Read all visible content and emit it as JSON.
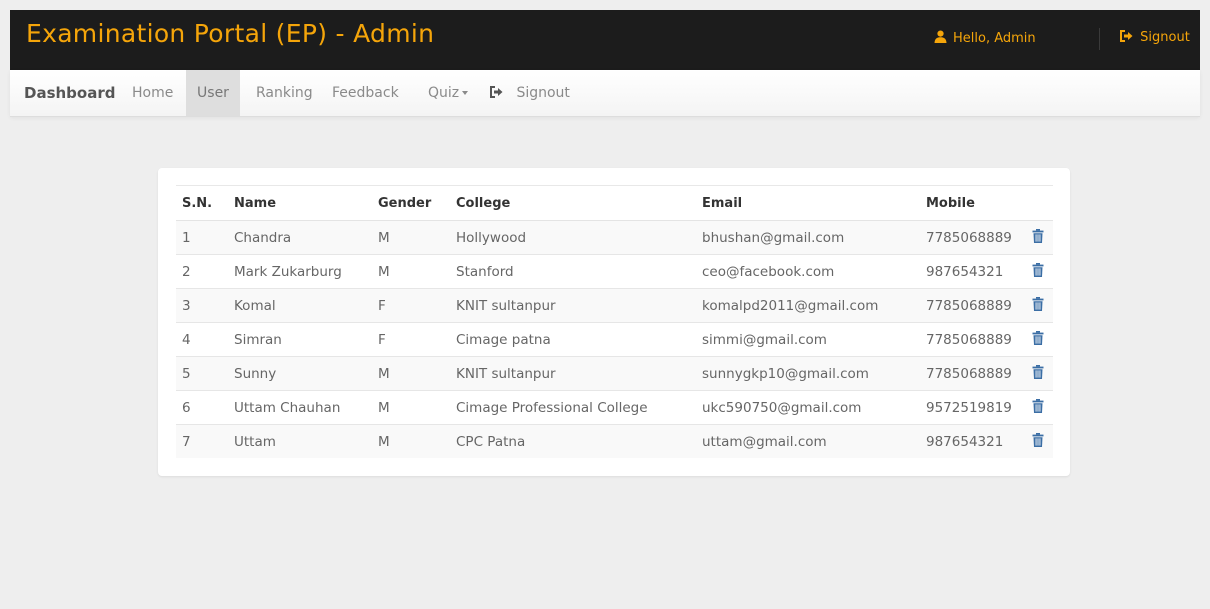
{
  "app": {
    "title": "Examination Portal (EP) - Admin",
    "greeting": "Hello,  Admin",
    "signout_label": "Signout",
    "accent_color": "#f5a50a",
    "header_bg": "#1c1c1c"
  },
  "nav": {
    "brand": "Dashboard",
    "home": "Home",
    "user": "User",
    "ranking": "Ranking",
    "feedback": "Feedback",
    "quiz": "Quiz",
    "signout": "Signout",
    "active": "User"
  },
  "table": {
    "headers": {
      "sn": "S.N.",
      "name": "Name",
      "gender": "Gender",
      "college": "College",
      "email": "Email",
      "mobile": "Mobile"
    },
    "rows": [
      {
        "sn": "1",
        "name": "Chandra",
        "gender": "M",
        "college": "Hollywood",
        "email": "bhushan@gmail.com",
        "mobile": "7785068889"
      },
      {
        "sn": "2",
        "name": "Mark Zukarburg",
        "gender": "M",
        "college": "Stanford",
        "email": "ceo@facebook.com",
        "mobile": "987654321"
      },
      {
        "sn": "3",
        "name": "Komal",
        "gender": "F",
        "college": "KNIT sultanpur",
        "email": "komalpd2011@gmail.com",
        "mobile": "7785068889"
      },
      {
        "sn": "4",
        "name": "Simran",
        "gender": "F",
        "college": "Cimage patna",
        "email": "simmi@gmail.com",
        "mobile": "7785068889"
      },
      {
        "sn": "5",
        "name": "Sunny",
        "gender": "M",
        "college": "KNIT sultanpur",
        "email": "sunnygkp10@gmail.com",
        "mobile": "7785068889"
      },
      {
        "sn": "6",
        "name": "Uttam Chauhan",
        "gender": "M",
        "college": "Cimage Professional College",
        "email": "ukc590750@gmail.com",
        "mobile": "9572519819"
      },
      {
        "sn": "7",
        "name": "Uttam",
        "gender": "M",
        "college": "CPC Patna",
        "email": "uttam@gmail.com",
        "mobile": "987654321"
      }
    ],
    "delete_icon": "trash-icon",
    "delete_icon_color": "#3b6ea5"
  }
}
